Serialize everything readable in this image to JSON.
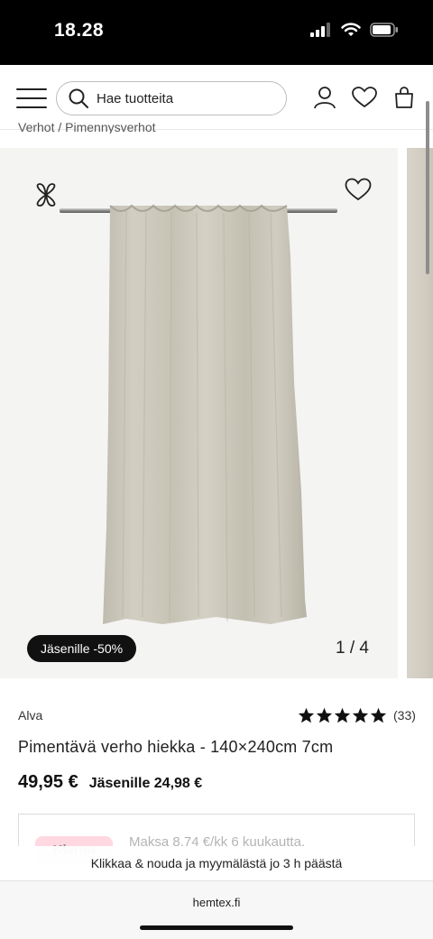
{
  "status_bar": {
    "time": "18.28",
    "signal_icon": "signal-icon",
    "wifi_icon": "wifi-icon",
    "battery_icon": "battery-icon"
  },
  "header": {
    "menu_icon": "hamburger-menu-icon",
    "search": {
      "placeholder": "Hae tuotteita",
      "value": ""
    },
    "account_icon": "user-icon",
    "wishlist_icon": "heart-icon",
    "cart_icon": "shopping-bag-icon"
  },
  "breadcrumb": "Verhot / Pimennysverhot",
  "gallery": {
    "member_badge": "Jäsenille -50%",
    "counter": "1 / 4",
    "current_image": 1,
    "total_images": 4
  },
  "product": {
    "brand": "Alva",
    "rating_value": 5,
    "rating_max": 5,
    "review_count": "(33)",
    "title": "Pimentävä verho hiekka - 140×240cm 7cm",
    "price": "49,95 €",
    "member_price": "Jäsenille 24,98 €"
  },
  "klarna": {
    "logo": "Klarna",
    "text": "Maksa 8,74 €/kk 6 kuukautta."
  },
  "sticky_notice": "Klikkaa & nouda ja myymälästä jo 3 h päästä",
  "browser": {
    "url": "hemtex.fi"
  },
  "colors": {
    "badge_bg": "#111111",
    "klarna_pink": "#ffb3c7",
    "curtain": "#cfcbbd"
  }
}
